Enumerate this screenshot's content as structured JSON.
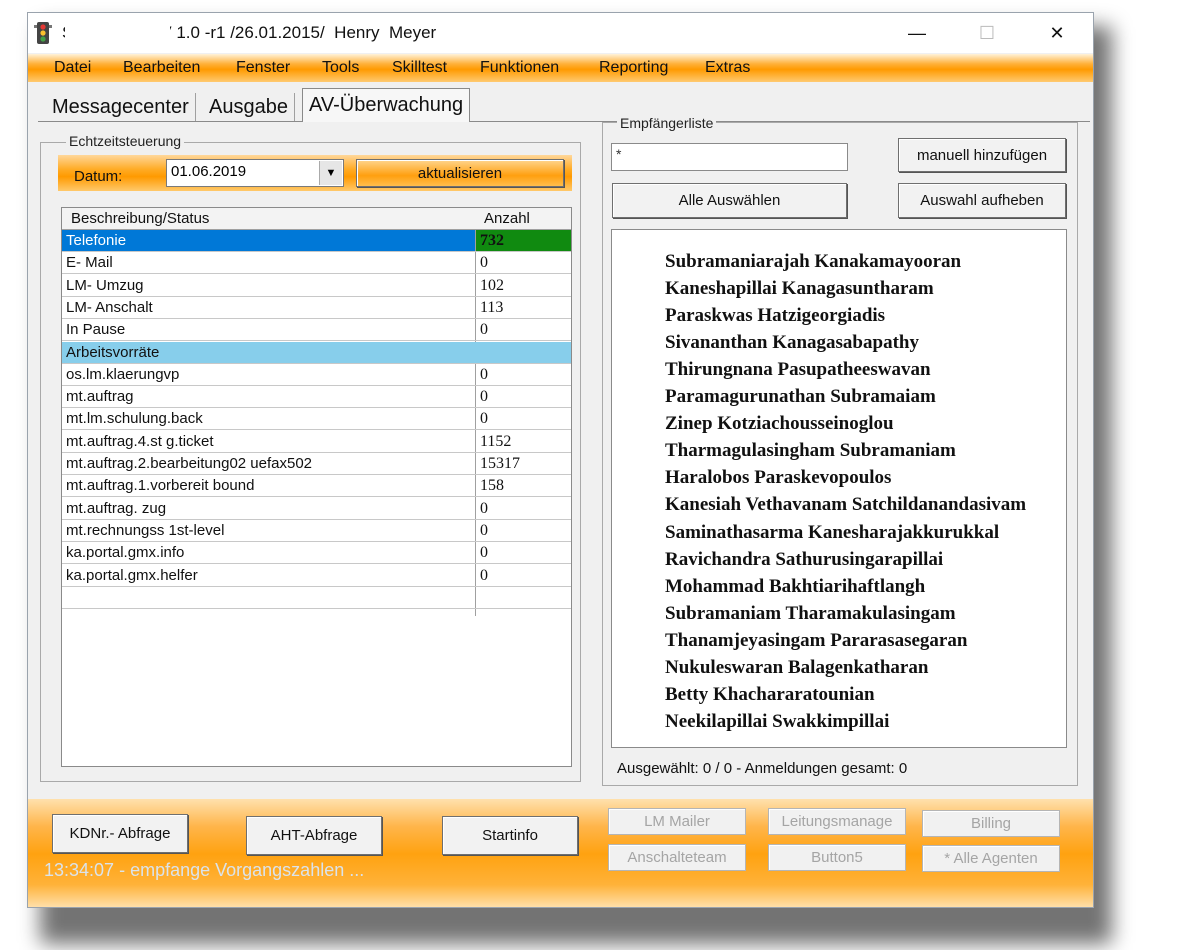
{
  "window": {
    "title": "Supervision  V 1.0 -r1 /26.01.2015/  Henry  Meyer",
    "minimize": "—",
    "maximize": "☐",
    "close": "✕"
  },
  "menu": [
    "Datei",
    "Bearbeiten",
    "Fenster",
    "Tools",
    "Skilltest",
    "Funktionen",
    "Reporting",
    "Extras"
  ],
  "tabs": [
    {
      "label": "Messagecenter",
      "active": false
    },
    {
      "label": "Ausgabe",
      "active": false
    },
    {
      "label": "AV-Überwachung",
      "active": true
    }
  ],
  "realtime": {
    "group_label": "Echtzeitsteuerung",
    "date_label": "Datum:",
    "date_value": "01.06.2019",
    "refresh_button": "aktualisieren"
  },
  "table": {
    "columns": [
      "Beschreibung/Status",
      "Anzahl"
    ],
    "rows": [
      {
        "name": "Telefonie",
        "count": "732",
        "style": "selected"
      },
      {
        "name": "E- Mail",
        "count": "0",
        "style": "normal"
      },
      {
        "name": "LM- Umzug",
        "count": "102",
        "style": "normal"
      },
      {
        "name": "LM- Anschalt",
        "count": "113",
        "style": "normal"
      },
      {
        "name": "In Pause",
        "count": "0",
        "style": "normal"
      },
      {
        "name": "Arbeitsvorräte",
        "count": "",
        "style": "section"
      },
      {
        "name": "os.lm.klaerungvp",
        "count": "0",
        "style": "normal"
      },
      {
        "name": "mt.auftrag",
        "count": "0",
        "style": "normal"
      },
      {
        "name": "mt.lm.schulung.back",
        "count": "0",
        "style": "normal"
      },
      {
        "name": "mt.auftrag.4.st          g.ticket",
        "count": "1152",
        "style": "normal"
      },
      {
        "name": "mt.auftrag.2.bearbeitung02          uefax502",
        "count": "15317",
        "style": "normal"
      },
      {
        "name": "mt.auftrag.1.vorbereit          bound",
        "count": "158",
        "style": "normal"
      },
      {
        "name": "mt.auftrag.    zug",
        "count": "0",
        "style": "normal"
      },
      {
        "name": "mt.rechnungss        1st-level",
        "count": "0",
        "style": "normal"
      },
      {
        "name": "ka.portal.gmx.info",
        "count": "0",
        "style": "normal"
      },
      {
        "name": "ka.portal.gmx.helfer",
        "count": "0",
        "style": "normal"
      },
      {
        "name": "",
        "count": "",
        "style": "normal"
      }
    ],
    "colors": {
      "selected_bg": "#0078d7",
      "count_highlight": "#108a10",
      "section_bg": "#87ceeb"
    }
  },
  "recipients": {
    "group_label": "Empfängerliste",
    "input_value": "*",
    "add_manual_button": "manuell hinzufügen",
    "select_all_button": "Alle Auswählen",
    "deselect_button": "Auswahl aufheben",
    "names": [
      "Subramaniarajah Kanakamayooran",
      "Kaneshapillai Kanagasuntharam",
      "Paraskwas Hatzigeorgiadis",
      "Sivananthan Kanagasabapathy",
      "Thirungnana Pasupatheeswavan",
      "Paramagurunathan Subramaiam",
      "Zinep Kotziachousseinoglou",
      "Tharmagulasingham Subramaniam",
      "Haralobos Paraskevopoulos",
      "Kanesiah Vethavanam Satchildanandasivam",
      "Saminathasarma Kanesharajakkurukkal",
      "Ravichandra Sathurusingarapillai",
      "Mohammad Bakhtiarihaftlangh",
      "Subramaniam Tharamakulasingam",
      "Thanamjeyasingam Pararasasegaran",
      "Nukuleswaran Balagenkatharan",
      "Betty Khachararatounian",
      "Neekilapillai Swakkimpillai"
    ],
    "status": "Ausgewählt: 0 / 0 - Anmeldungen gesamt: 0"
  },
  "bottom": {
    "buttons": {
      "kdnr": "KDNr.- Abfrage",
      "aht": "AHT-Abfrage",
      "startinfo": "Startinfo",
      "lm_mailer": "LM Mailer",
      "leitungsmanage": "Leitungsmanage",
      "billing": "Billing",
      "anschalteteam": "Anschalteteam",
      "button5": "Button5",
      "alle_agenten": "* Alle Agenten"
    },
    "log": "13:34:07 - empfange Vorgangszahlen ..."
  },
  "colors": {
    "accent_orange": "#ff9a00",
    "brand_bar": "#ffb13a"
  }
}
